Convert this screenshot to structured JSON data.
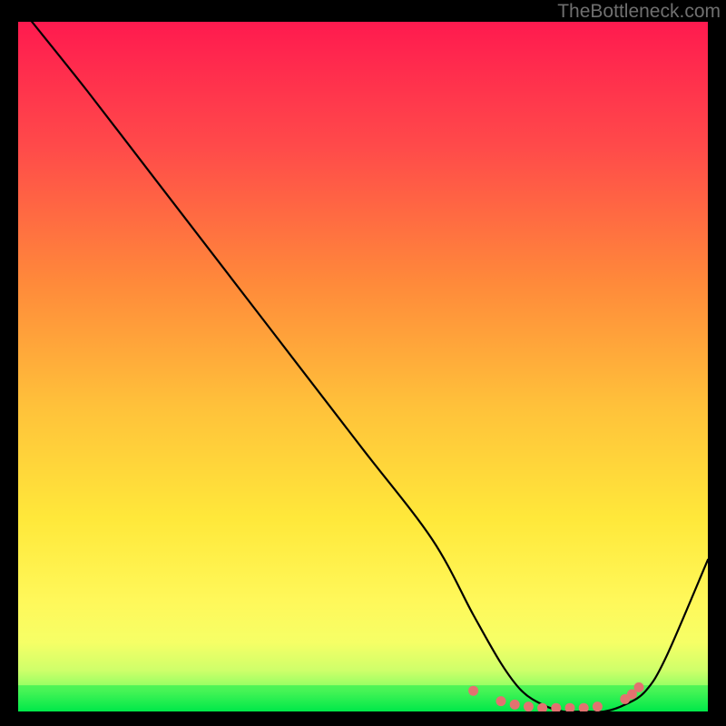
{
  "attribution": "TheBottleneck.com",
  "chart_data": {
    "type": "line",
    "title": "",
    "xlabel": "",
    "ylabel": "",
    "xlim": [
      0,
      100
    ],
    "ylim": [
      0,
      100
    ],
    "x": [
      2,
      10,
      20,
      30,
      40,
      50,
      60,
      66,
      70,
      73,
      76,
      79,
      82,
      85,
      88,
      91,
      94,
      100
    ],
    "values": [
      100,
      90,
      77,
      64,
      51,
      38,
      25,
      14,
      7,
      3,
      1,
      0,
      0,
      0,
      1,
      3,
      8,
      22
    ],
    "valley_dots": [
      {
        "x": 66,
        "y": 3
      },
      {
        "x": 70,
        "y": 1.5
      },
      {
        "x": 72,
        "y": 1
      },
      {
        "x": 74,
        "y": 0.7
      },
      {
        "x": 76,
        "y": 0.5
      },
      {
        "x": 78,
        "y": 0.5
      },
      {
        "x": 80,
        "y": 0.5
      },
      {
        "x": 82,
        "y": 0.5
      },
      {
        "x": 84,
        "y": 0.7
      },
      {
        "x": 88,
        "y": 1.8
      },
      {
        "x": 89,
        "y": 2.5
      },
      {
        "x": 90,
        "y": 3.5
      }
    ],
    "gradient_stops": [
      {
        "offset": 0.0,
        "color": "#ff1a4f"
      },
      {
        "offset": 0.18,
        "color": "#ff4a4a"
      },
      {
        "offset": 0.38,
        "color": "#ff8a3a"
      },
      {
        "offset": 0.56,
        "color": "#ffc23a"
      },
      {
        "offset": 0.72,
        "color": "#ffe83a"
      },
      {
        "offset": 0.84,
        "color": "#fff85a"
      },
      {
        "offset": 0.9,
        "color": "#f6ff66"
      },
      {
        "offset": 0.94,
        "color": "#cfff6a"
      },
      {
        "offset": 0.97,
        "color": "#86ff62"
      },
      {
        "offset": 1.0,
        "color": "#00e84a"
      }
    ],
    "green_band_y": 96.2
  }
}
